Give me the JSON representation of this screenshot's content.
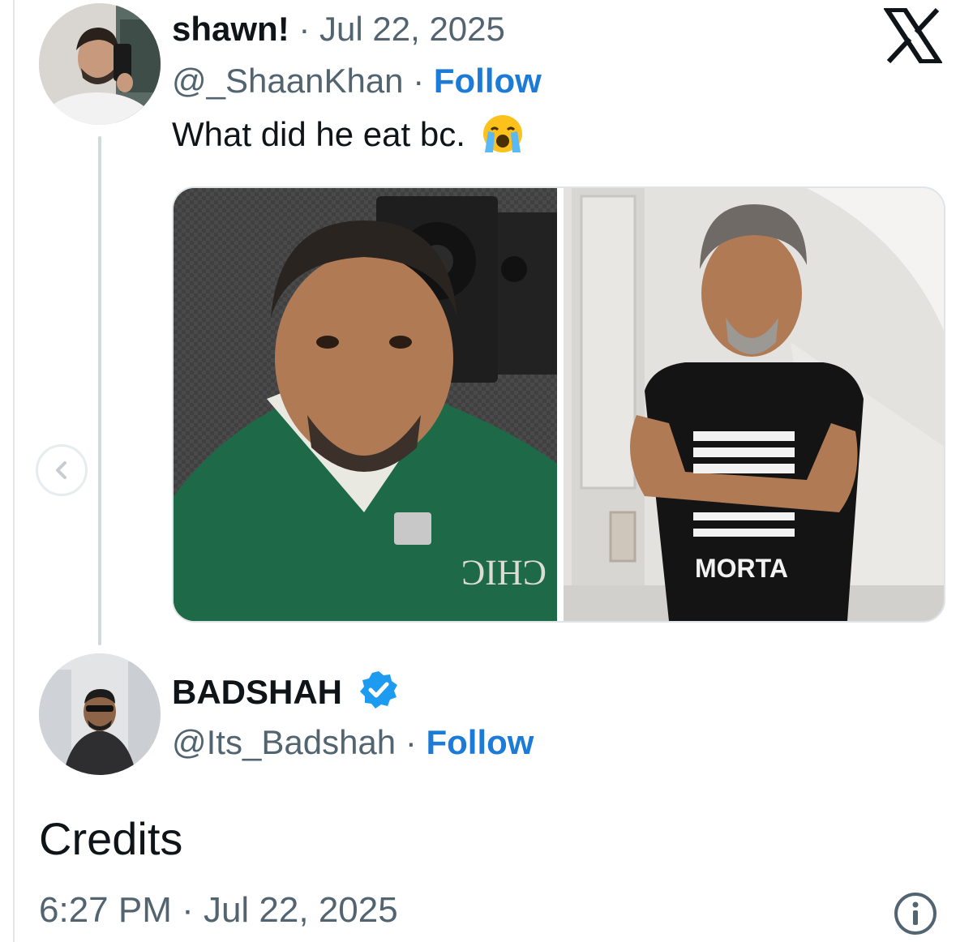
{
  "tweet": {
    "author_name": "shawn!",
    "date": "Jul 22, 2025",
    "handle": "@_ShaanKhan",
    "follow_label": "Follow",
    "text": "What did he eat bc.",
    "emoji": "loudly-crying-face-icon",
    "image_left_text": "CHIC",
    "image_right_text": "MORTA"
  },
  "reply": {
    "author_name": "BADSHAH",
    "verified": true,
    "handle": "@Its_Badshah",
    "follow_label": "Follow",
    "text": "Credits",
    "timestamp": "6:27 PM · Jul 22, 2025"
  },
  "separator": "·",
  "icons": {
    "close": "x-logo-icon",
    "info": "info-icon",
    "prev": "chevron-left-icon",
    "verified": "verified-badge-icon"
  },
  "colors": {
    "link_blue": "#1d7bd8",
    "muted_gray": "#536471",
    "text": "#0f1419",
    "verified_blue": "#1d9bf0"
  }
}
